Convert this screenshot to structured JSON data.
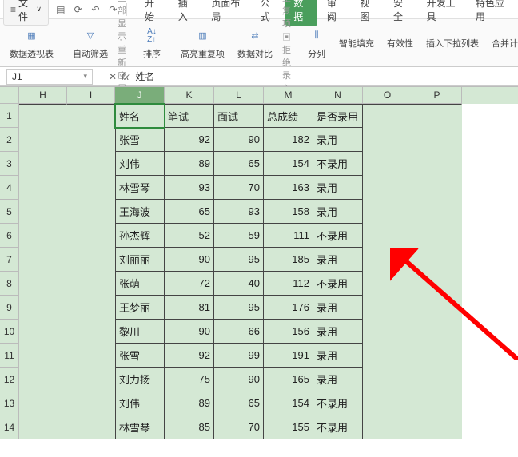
{
  "menu": {
    "file": "文件",
    "tabs": [
      "开始",
      "插入",
      "页面布局",
      "公式",
      "数据",
      "审阅",
      "视图",
      "安全",
      "开发工具",
      "特色应用"
    ],
    "active_tab_index": 4
  },
  "ribbon": {
    "pivot": "数据透视表",
    "autofilter": "自动筛选",
    "showall": "全部显示",
    "reapply": "重新应用",
    "sort": "排序",
    "highlight": "高亮重复项",
    "datacompare": "数据对比",
    "deldup": "删除重复项",
    "rejectdup": "拒绝录入重复项",
    "texttocols": "分列",
    "flashfill": "智能填充",
    "validation": "有效性",
    "dropdown": "插入下拉列表",
    "consolidate": "合并计算"
  },
  "fbar": {
    "cellref": "J1",
    "formula": "姓名"
  },
  "cols": [
    "H",
    "I",
    "J",
    "K",
    "L",
    "M",
    "N",
    "O",
    "P"
  ],
  "header": [
    "姓名",
    "笔试",
    "面试",
    "总成绩",
    "是否录用"
  ],
  "chart_data": {
    "type": "table",
    "title": "",
    "columns": [
      "姓名",
      "笔试",
      "面试",
      "总成绩",
      "是否录用"
    ],
    "rows": [
      [
        "张雪",
        92,
        90,
        182,
        "录用"
      ],
      [
        "刘伟",
        89,
        65,
        154,
        "不录用"
      ],
      [
        "林雪琴",
        93,
        70,
        163,
        "录用"
      ],
      [
        "王海波",
        65,
        93,
        158,
        "录用"
      ],
      [
        "孙杰辉",
        52,
        59,
        111,
        "不录用"
      ],
      [
        "刘丽丽",
        90,
        95,
        185,
        "录用"
      ],
      [
        "张萌",
        72,
        40,
        112,
        "不录用"
      ],
      [
        "王梦丽",
        81,
        95,
        176,
        "录用"
      ],
      [
        "黎川",
        90,
        66,
        156,
        "录用"
      ],
      [
        "张雪",
        92,
        99,
        191,
        "录用"
      ],
      [
        "刘力扬",
        75,
        90,
        165,
        "录用"
      ],
      [
        "刘伟",
        89,
        65,
        154,
        "不录用"
      ],
      [
        "林雪琴",
        85,
        70,
        155,
        "不录用"
      ]
    ]
  }
}
